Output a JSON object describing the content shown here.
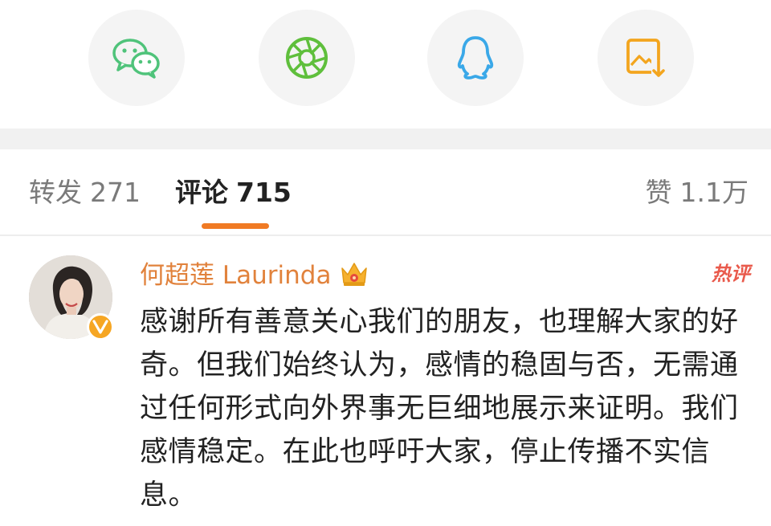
{
  "share": {
    "buttons": [
      {
        "icon": "wechat-icon",
        "color": "#4fc37a"
      },
      {
        "icon": "moments-icon",
        "color": "#5fbf3c"
      },
      {
        "icon": "qq-icon",
        "color": "#3aa8e8"
      },
      {
        "icon": "save-image-icon",
        "color": "#f3a51e"
      }
    ]
  },
  "tabs": {
    "repost": {
      "label": "转发",
      "count": "271"
    },
    "comment": {
      "label": "评论",
      "count": "715"
    },
    "likes": {
      "label": "赞",
      "count": "1.1万"
    },
    "accent_color": "#f07a24"
  },
  "comment": {
    "username": "何超莲 Laurinda",
    "username_color": "#e1823c",
    "hot_badge": "热评",
    "text": "感谢所有善意关心我们的朋友，也理解大家的好奇。但我们始终认为，感情的稳固与否，无需通过任何形式向外界事无巨细地展示来证明。我们感情稳定。在此也呼吁大家，停止传播不实信息。"
  }
}
